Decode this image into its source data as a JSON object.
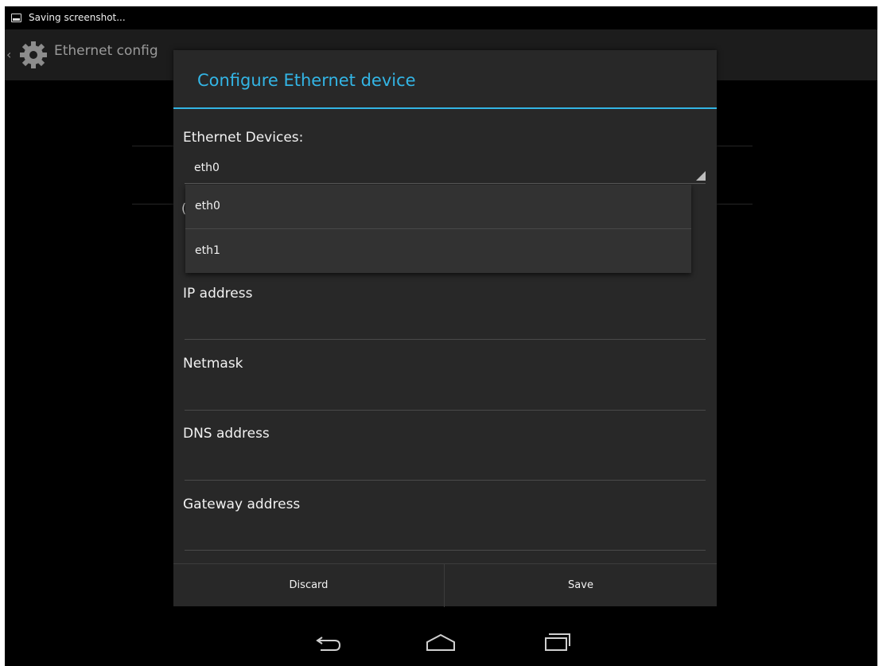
{
  "statusbar": {
    "text": "Saving screenshot..."
  },
  "actionbar": {
    "title": "Ethernet config"
  },
  "dialog": {
    "title": "Configure Ethernet device",
    "devices_label": "Ethernet Devices:",
    "selected_device": "eth0",
    "obscured_char": "(",
    "options": [
      "eth0",
      "eth1"
    ],
    "fields": [
      {
        "label": "IP address",
        "value": ""
      },
      {
        "label": "Netmask",
        "value": ""
      },
      {
        "label": "DNS address",
        "value": ""
      },
      {
        "label": "Gateway address",
        "value": ""
      }
    ],
    "discard_label": "Discard",
    "save_label": "Save"
  },
  "colors": {
    "accent": "#33b5e5",
    "dialog_bg": "#282828",
    "dropdown_bg": "#323232"
  },
  "icons": [
    "image-icon",
    "gear-icon",
    "back-icon",
    "home-icon",
    "recents-icon",
    "dropdown-triangle-icon"
  ]
}
